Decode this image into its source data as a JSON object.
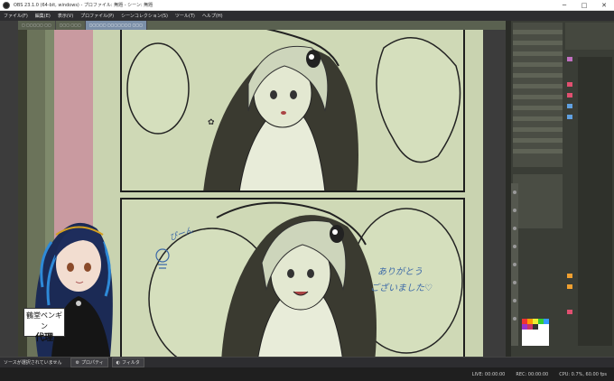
{
  "window": {
    "title": "OBS 23.1.0 (64-bit, windows) - プロファイル: 無題 - シーン: 無題",
    "minimize": "─",
    "maximize": "□",
    "close": "✕"
  },
  "menu": {
    "items": [
      "ファイル(F)",
      "編集(E)",
      "表示(V)",
      "プロファイル(P)",
      "シーンコレクション(S)",
      "ツール(T)",
      "ヘルプ(H)"
    ]
  },
  "preview": {
    "sfx_left": "ぴーん",
    "speech_text_line1": "ありがとう",
    "speech_text_line2": "ございました♡",
    "vtuber_label_line1": "鶴堂ペンギン",
    "vtuber_label_line2": "代理"
  },
  "bottom": {
    "no_source_text": "ソースが選択されていません",
    "properties_label": "プロパティ",
    "filters_label": "フィルタ"
  },
  "status": {
    "live": "LIVE: 00:00:00",
    "rec": "REC: 00:00:00",
    "cpu": "CPU: 0.7%, 60.00 fps"
  },
  "colors": {
    "canvas_bg": "#c9d3b0",
    "pink_strip": "#c99aa0",
    "csp_tab_active": "#7b8fa8"
  }
}
